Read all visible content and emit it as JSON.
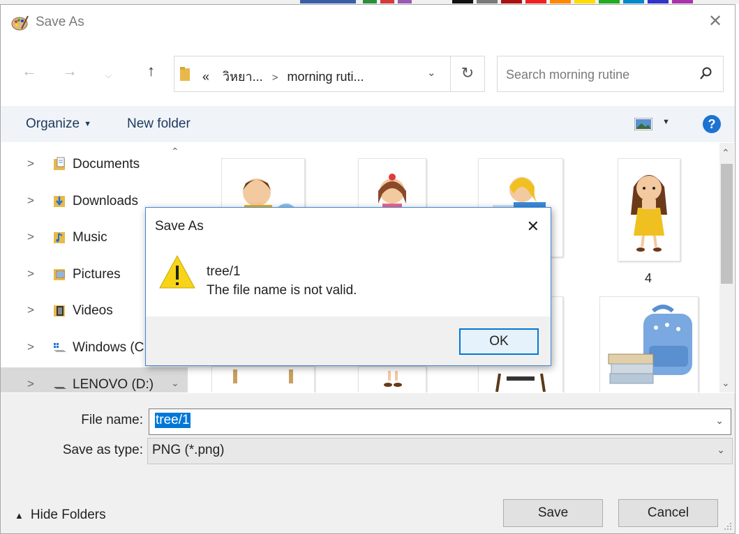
{
  "window": {
    "title": "Save As",
    "close_icon": "close-icon"
  },
  "nav": {
    "back_icon": "back-arrow-icon",
    "forward_icon": "forward-arrow-icon",
    "recent_icon": "chevron-down-icon",
    "up_icon": "up-arrow-icon"
  },
  "address": {
    "overflow": "«",
    "crumbs": [
      "วิหยา...",
      "morning ruti..."
    ],
    "refresh_icon": "refresh-icon"
  },
  "search": {
    "placeholder": "Search morning rutine"
  },
  "toolbar": {
    "organize": "Organize",
    "new_folder": "New folder",
    "help": "?"
  },
  "sidebar": {
    "items": [
      {
        "label": "Documents",
        "icon": "documents-folder-icon"
      },
      {
        "label": "Downloads",
        "icon": "downloads-folder-icon"
      },
      {
        "label": "Music",
        "icon": "music-folder-icon"
      },
      {
        "label": "Pictures",
        "icon": "pictures-folder-icon"
      },
      {
        "label": "Videos",
        "icon": "videos-folder-icon"
      },
      {
        "label": "Windows (C",
        "icon": "windows-drive-icon"
      },
      {
        "label": "LENOVO (D:)",
        "icon": "drive-icon",
        "selected": true
      }
    ]
  },
  "files": {
    "captions": [
      "4"
    ]
  },
  "form": {
    "file_name_label": "File name:",
    "file_name_value": "tree/1",
    "save_type_label": "Save as type:",
    "save_type_value": "PNG (*.png)"
  },
  "footer": {
    "hide_folders": "Hide Folders",
    "save": "Save",
    "cancel": "Cancel"
  },
  "alert": {
    "title": "Save As",
    "line1": "tree/1",
    "line2": "The file name is not valid.",
    "ok": "OK",
    "icon": "warning-icon"
  },
  "colors": {
    "accent": "#0078d7",
    "toolbar_bg": "#f0f4f9",
    "help_blue": "#1e73d2",
    "warning_yellow": "#f7d418"
  }
}
